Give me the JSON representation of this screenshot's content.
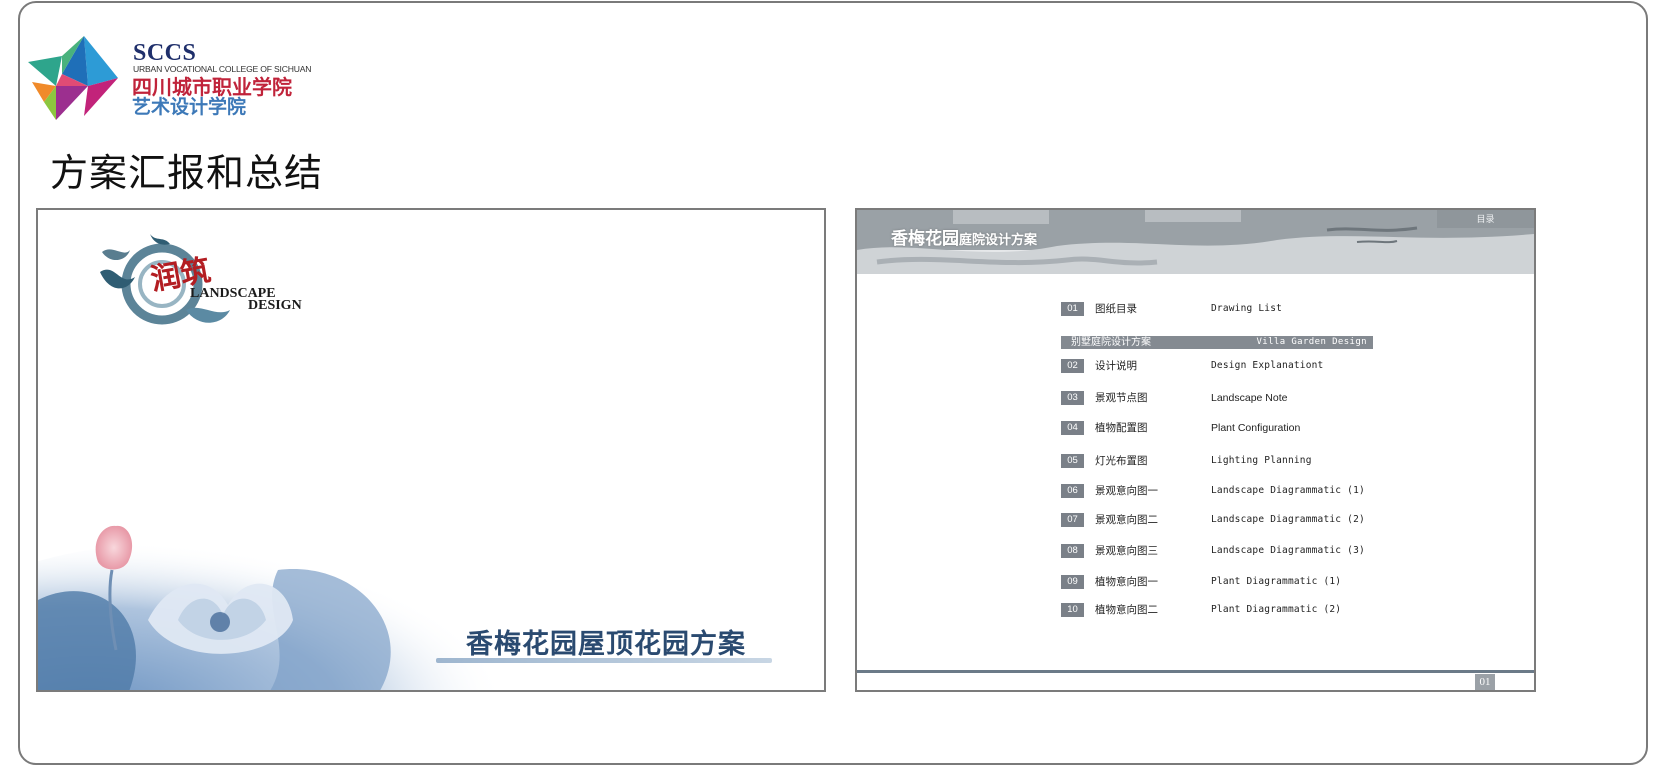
{
  "school": {
    "abbr": "SCCS",
    "en_name": "URBAN VOCATIONAL COLLEGE OF SICHUAN",
    "cn_name": "四川城市职业学院",
    "dept": "艺术设计学院"
  },
  "page_title": "方案汇报和总结",
  "cover_slide": {
    "brand_cn": "润筑",
    "brand_en_line1": "LANDSCAPE",
    "brand_en_line2": "DESIGN",
    "title": "香梅花园屋顶花园方案"
  },
  "toc_slide": {
    "header_title_big": "香梅花园",
    "header_title_small": "庭院设计方案",
    "tab_label": "目录",
    "section_cn": "别墅庭院设计方案",
    "section_en": "Villa Garden Design",
    "page_number": "01",
    "items": [
      {
        "num": "01",
        "cn": "图纸目录",
        "en": "Drawing List"
      },
      {
        "num": "02",
        "cn": "设计说明",
        "en": "Design Explanationt"
      },
      {
        "num": "03",
        "cn": "景观节点图",
        "en": "Landscape Note"
      },
      {
        "num": "04",
        "cn": "植物配置图",
        "en": "Plant Configuration"
      },
      {
        "num": "05",
        "cn": "灯光布置图",
        "en": "Lighting Planning"
      },
      {
        "num": "06",
        "cn": "景观意向图一",
        "en": "Landscape Diagrammatic (1)"
      },
      {
        "num": "07",
        "cn": "景观意向图二",
        "en": "Landscape Diagrammatic (2)"
      },
      {
        "num": "08",
        "cn": "景观意向图三",
        "en": "Landscape Diagrammatic (3)"
      },
      {
        "num": "09",
        "cn": "植物意向图一",
        "en": "Plant Diagrammatic (1)"
      },
      {
        "num": "10",
        "cn": "植物意向图二",
        "en": "Plant Diagrammatic (2)"
      }
    ]
  }
}
